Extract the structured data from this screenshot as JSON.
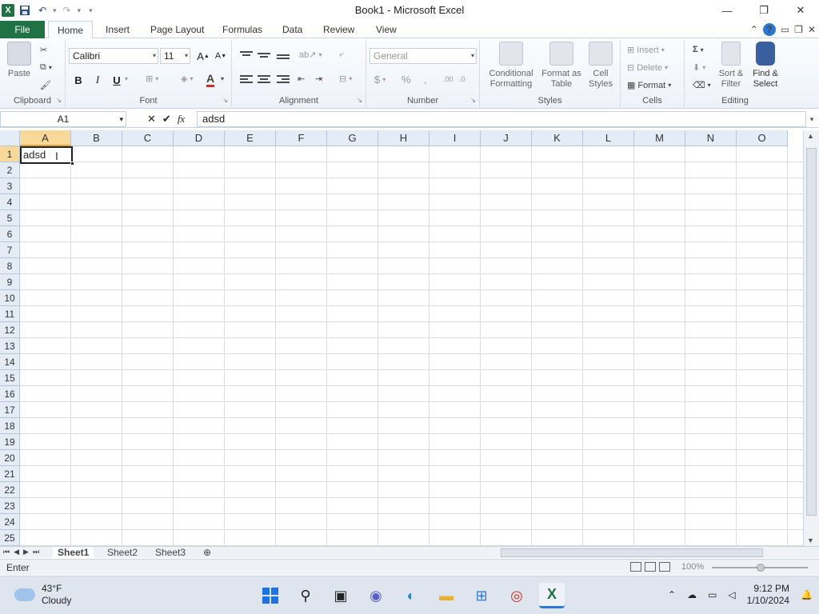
{
  "window": {
    "title": "Book1 - Microsoft Excel",
    "logo": "X",
    "controls": [
      "minimize-icon",
      "restore-icon",
      "close-icon"
    ]
  },
  "tabs": [
    "File",
    "Home",
    "Insert",
    "Page Layout",
    "Formulas",
    "Data",
    "Review",
    "View"
  ],
  "ribbon": {
    "clipboard": {
      "label": "Clipboard",
      "paste": "Paste"
    },
    "font": {
      "label": "Font",
      "name": "Calibri",
      "size": "11",
      "bold": "B",
      "italic": "I",
      "underline": "U"
    },
    "alignment": {
      "label": "Alignment"
    },
    "number": {
      "label": "Number",
      "format": "General",
      "currency": "$",
      "percent": "%",
      "comma": ","
    },
    "styles": {
      "label": "Styles",
      "conditional": "Conditional Formatting",
      "format_table": "Format as Table",
      "cell_styles": "Cell Styles"
    },
    "cells": {
      "label": "Cells",
      "insert": "Insert",
      "delete": "Delete",
      "format": "Format"
    },
    "editing": {
      "label": "Editing",
      "sum": "Σ",
      "sort": "Sort & Filter",
      "find": "Find & Select"
    }
  },
  "formula_bar": {
    "name_box": "A1",
    "fx": "fx",
    "content": "adsd"
  },
  "grid": {
    "columns": [
      "A",
      "B",
      "C",
      "D",
      "E",
      "F",
      "G",
      "H",
      "I",
      "J",
      "K",
      "L",
      "M",
      "N",
      "O"
    ],
    "rows": [
      "1",
      "2",
      "3",
      "4",
      "5",
      "6",
      "7",
      "8",
      "9",
      "10",
      "11",
      "12",
      "13",
      "14",
      "15",
      "16",
      "17",
      "18",
      "19",
      "20",
      "21",
      "22",
      "23",
      "24",
      "25"
    ],
    "active_cell": "A1",
    "active_value": "adsd"
  },
  "sheets": [
    "Sheet1",
    "Sheet2",
    "Sheet3"
  ],
  "active_sheet": "Sheet1",
  "status": {
    "mode": "Enter",
    "zoom": "100%"
  },
  "taskbar": {
    "weather_temp": "43°F",
    "weather_desc": "Cloudy",
    "time": "9:12 PM",
    "date": "1/10/2024"
  },
  "colors": {
    "excel_green": "#1f7244",
    "selected_header": "#f9d99a",
    "gridline": "#dadcdd"
  }
}
